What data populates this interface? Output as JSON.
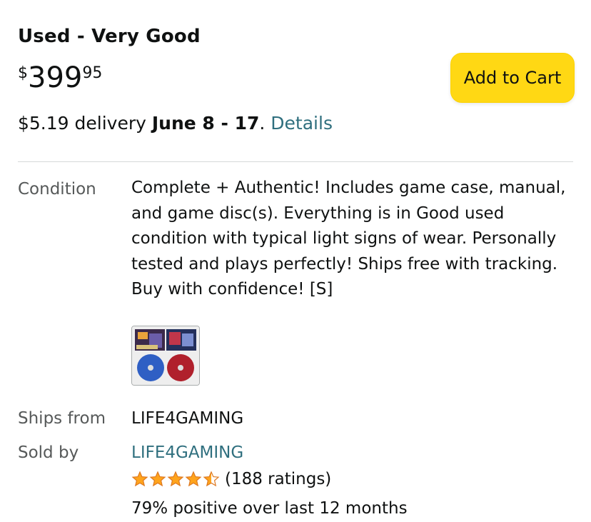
{
  "offer": {
    "condition": "Used - Very Good",
    "price": {
      "symbol": "$",
      "whole": "399",
      "fraction": "95"
    },
    "add_to_cart_label": "Add to Cart",
    "delivery": {
      "prefix": "$5.19 delivery ",
      "dates": "June 8 - 17",
      "suffix": ". ",
      "details_label": "Details"
    }
  },
  "details": {
    "condition_label": "Condition",
    "condition_text": "Complete + Authentic! Includes game case, manual, and game disc(s). Everything is in Good used condition with typical light signs of wear. Personally tested and plays perfectly! Ships free with tracking. Buy with confidence! [S]",
    "ships_from_label": "Ships from",
    "ships_from_value": "LIFE4GAMING",
    "sold_by_label": "Sold by",
    "sold_by_value": "LIFE4GAMING",
    "rating": {
      "stars": 4.5,
      "ratings_text": "(188 ratings)"
    },
    "positive_text": "79% positive over last 12 months"
  },
  "colors": {
    "accent_button": "#ffd814",
    "link": "#2f6f7e",
    "star": "#ffa41c"
  }
}
